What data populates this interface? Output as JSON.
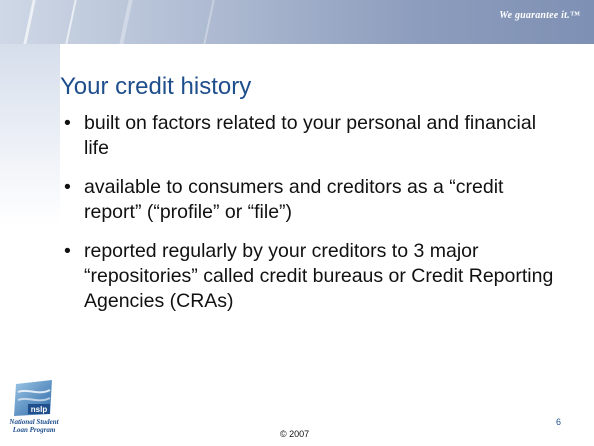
{
  "header": {
    "tagline": "We guarantee it.™"
  },
  "slide": {
    "title": "Your credit history",
    "bullets": [
      "built on factors related to your personal and financial life",
      "available to consumers and creditors as a “credit report” (“profile” or “file”)",
      "reported regularly by your creditors to 3 major “repositories” called credit bureaus or Credit Reporting Agencies (CRAs)"
    ]
  },
  "logo": {
    "mark": "nslp",
    "line1": "National Student",
    "line2": "Loan Program"
  },
  "footer": {
    "copyright": "© 2007",
    "page_number": "6"
  },
  "colors": {
    "title": "#1f4e8c",
    "header_band": "#8d9dbd",
    "text": "#111111"
  }
}
